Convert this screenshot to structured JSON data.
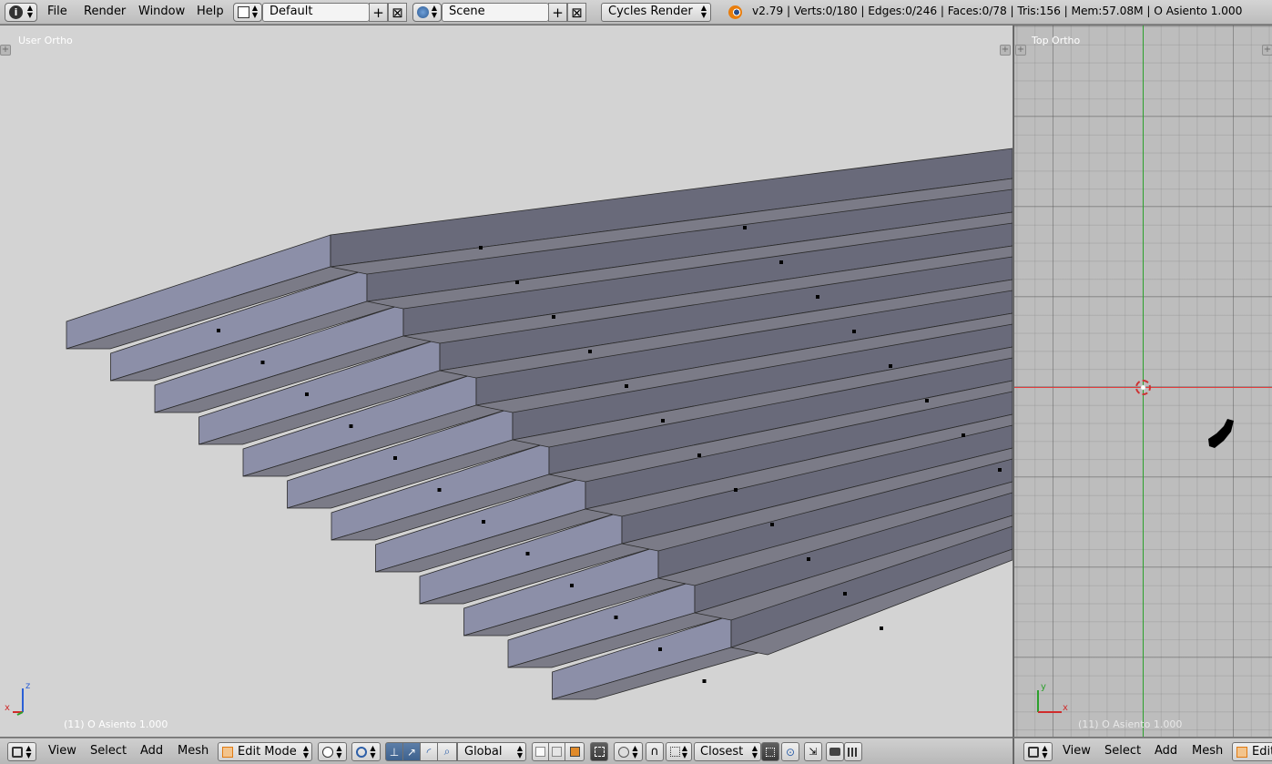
{
  "header": {
    "menus": [
      "File",
      "Render",
      "Window",
      "Help"
    ],
    "layout_name": "Default",
    "scene_name": "Scene",
    "render_engine": "Cycles Render",
    "stats": "v2.79 | Verts:0/180 | Edges:0/246 | Faces:0/78 | Tris:156 | Mem:57.08M | O Asiento 1.000"
  },
  "viewport_left": {
    "view_label": "User Ortho",
    "object_info": "(11) O Asiento 1.000",
    "axis_x": "x",
    "axis_z": "z"
  },
  "viewport_right": {
    "view_label": "Top Ortho",
    "object_info": "(11) O Asiento 1.000",
    "axis_x": "x",
    "axis_y": "y"
  },
  "footer_left": {
    "menus": [
      "View",
      "Select",
      "Add",
      "Mesh"
    ],
    "mode": "Edit Mode",
    "orientation": "Global",
    "snap_target": "Closest"
  },
  "footer_right": {
    "menus": [
      "View",
      "Select",
      "Add",
      "Mesh"
    ],
    "mode_partial": "Edit"
  },
  "colors": {
    "viewport_bg": "#d3d3d3",
    "grid_bg": "#bdbdbd",
    "face_front": "#8c8fa8",
    "face_top": "#7b7b87",
    "face_riser": "#696a7a",
    "x_axis": "#e23c3c",
    "y_axis": "#2ca02c"
  }
}
